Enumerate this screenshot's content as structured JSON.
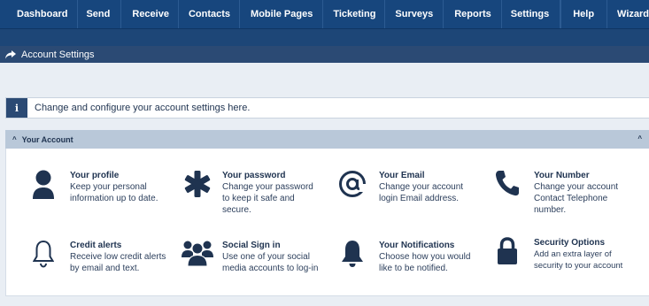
{
  "nav": {
    "items": [
      "Dashboard",
      "Send",
      "Receive",
      "Contacts",
      "Mobile Pages",
      "Ticketing",
      "Surveys",
      "Reports",
      "Settings"
    ],
    "right_items": [
      "Help",
      "Wizard"
    ]
  },
  "breadcrumb": {
    "label": "Account Settings"
  },
  "info": {
    "text": "Change and configure your account settings here."
  },
  "panel": {
    "title": "Your Account"
  },
  "cards": [
    {
      "title": "Your profile",
      "desc": "Keep your personal information up to date.",
      "icon": "user-icon"
    },
    {
      "title": "Your password",
      "desc": "Change your password to keep it safe and secure.",
      "icon": "asterisk-icon"
    },
    {
      "title": "Your Email",
      "desc": "Change your account login Email address.",
      "icon": "at-icon"
    },
    {
      "title": "Your Number",
      "desc": "Change your account Contact Telephone number.",
      "icon": "phone-icon"
    },
    {
      "title": "Credit alerts",
      "desc": "Receive low credit alerts by email and text.",
      "icon": "bell-outline-icon"
    },
    {
      "title": "Social Sign in",
      "desc": "Use one of your social media accounts to log-in",
      "icon": "users-icon"
    },
    {
      "title": "Your Notifications",
      "desc": "Choose how you would like to be notified.",
      "icon": "bell-icon"
    },
    {
      "title": "Security Options",
      "desc": "Add an extra layer of security to your account",
      "icon": "lock-icon"
    }
  ],
  "colors": {
    "nav_bg": "#17467d",
    "subbar_bg": "#2b4a74",
    "panel_header": "#b9c8d9",
    "page_bg": "#e9eef4"
  }
}
